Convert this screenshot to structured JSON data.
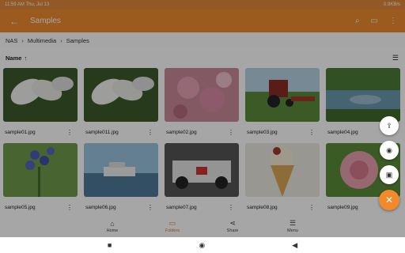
{
  "status": {
    "time": "11:59 AM",
    "date": "Thu, Jul 13",
    "right": "0.9KB/s"
  },
  "appbar": {
    "title": "Samples",
    "back_icon": "arrow-left-icon",
    "search_icon": "search-icon",
    "cast_icon": "cast-icon",
    "more_icon": "more-vert-icon"
  },
  "breadcrumb": [
    "NAS",
    "Multimedia",
    "Samples"
  ],
  "sort": {
    "label": "Name",
    "arrow": "↑"
  },
  "files": [
    {
      "name": "sample01.jpg",
      "thumb": "white-flowers"
    },
    {
      "name": "sample011.jpg",
      "thumb": "white-flowers"
    },
    {
      "name": "sample02.jpg",
      "thumb": "pink-blossom"
    },
    {
      "name": "sample03.jpg",
      "thumb": "tractor"
    },
    {
      "name": "sample04.jpg",
      "thumb": "pond"
    },
    {
      "name": "sample05.jpg",
      "thumb": "blue-flowers"
    },
    {
      "name": "sample06.jpg",
      "thumb": "boat"
    },
    {
      "name": "sample07.jpg",
      "thumb": "race-car"
    },
    {
      "name": "sample08.jpg",
      "thumb": "ice-cream"
    },
    {
      "name": "sample09.jpg",
      "thumb": "pink-flower"
    }
  ],
  "fab": {
    "upload_icon": "upload-icon",
    "camera_icon": "camera-icon",
    "folder_icon": "new-folder-icon",
    "close_icon": "close-icon"
  },
  "bottomnav": [
    {
      "label": "Home",
      "icon": "home-icon",
      "active": false
    },
    {
      "label": "Folders",
      "icon": "folder-icon",
      "active": true
    },
    {
      "label": "Share",
      "icon": "share-icon",
      "active": false
    },
    {
      "label": "Menu",
      "icon": "menu-icon",
      "active": false
    }
  ],
  "colors": {
    "accent": "#ee8a2e"
  }
}
